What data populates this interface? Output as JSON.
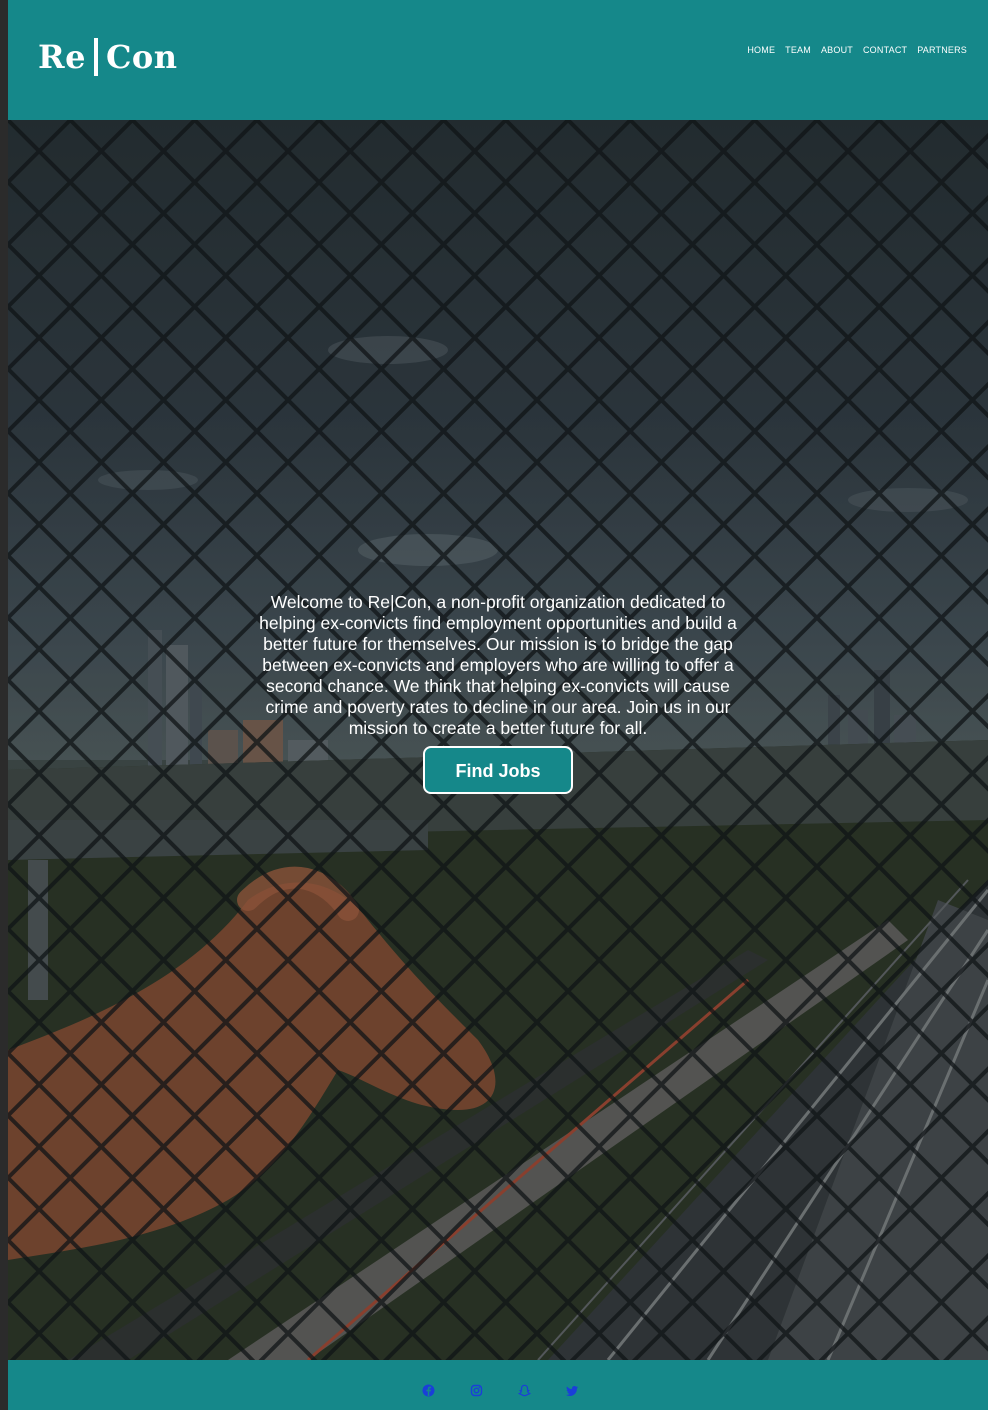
{
  "header": {
    "logo_left": "Re",
    "logo_right": "Con",
    "nav": [
      "HOME",
      "TEAM",
      "ABOUT",
      "CONTACT",
      "PARTNERS"
    ]
  },
  "hero": {
    "text": "Welcome to Re|Con, a non-profit organization dedicated to helping ex-convicts find employment opportunities and build a better future for themselves. Our mission is to bridge the gap between ex-convicts and employers who are willing to offer a second chance. We think that helping ex-convicts will cause crime and poverty rates to decline in our area. Join us in our mission to create a better future for all.",
    "button_label": "Find Jobs",
    "image_subject": "city railway seen through a torn chain-link fence with a hand reaching out"
  },
  "footer": {
    "social_icons": [
      "facebook-icon",
      "instagram-icon",
      "snapchat-icon",
      "twitter-icon"
    ]
  },
  "colors": {
    "brand": "#15888a",
    "text_light": "#ffffff",
    "social_icon": "#1a3fd8"
  }
}
